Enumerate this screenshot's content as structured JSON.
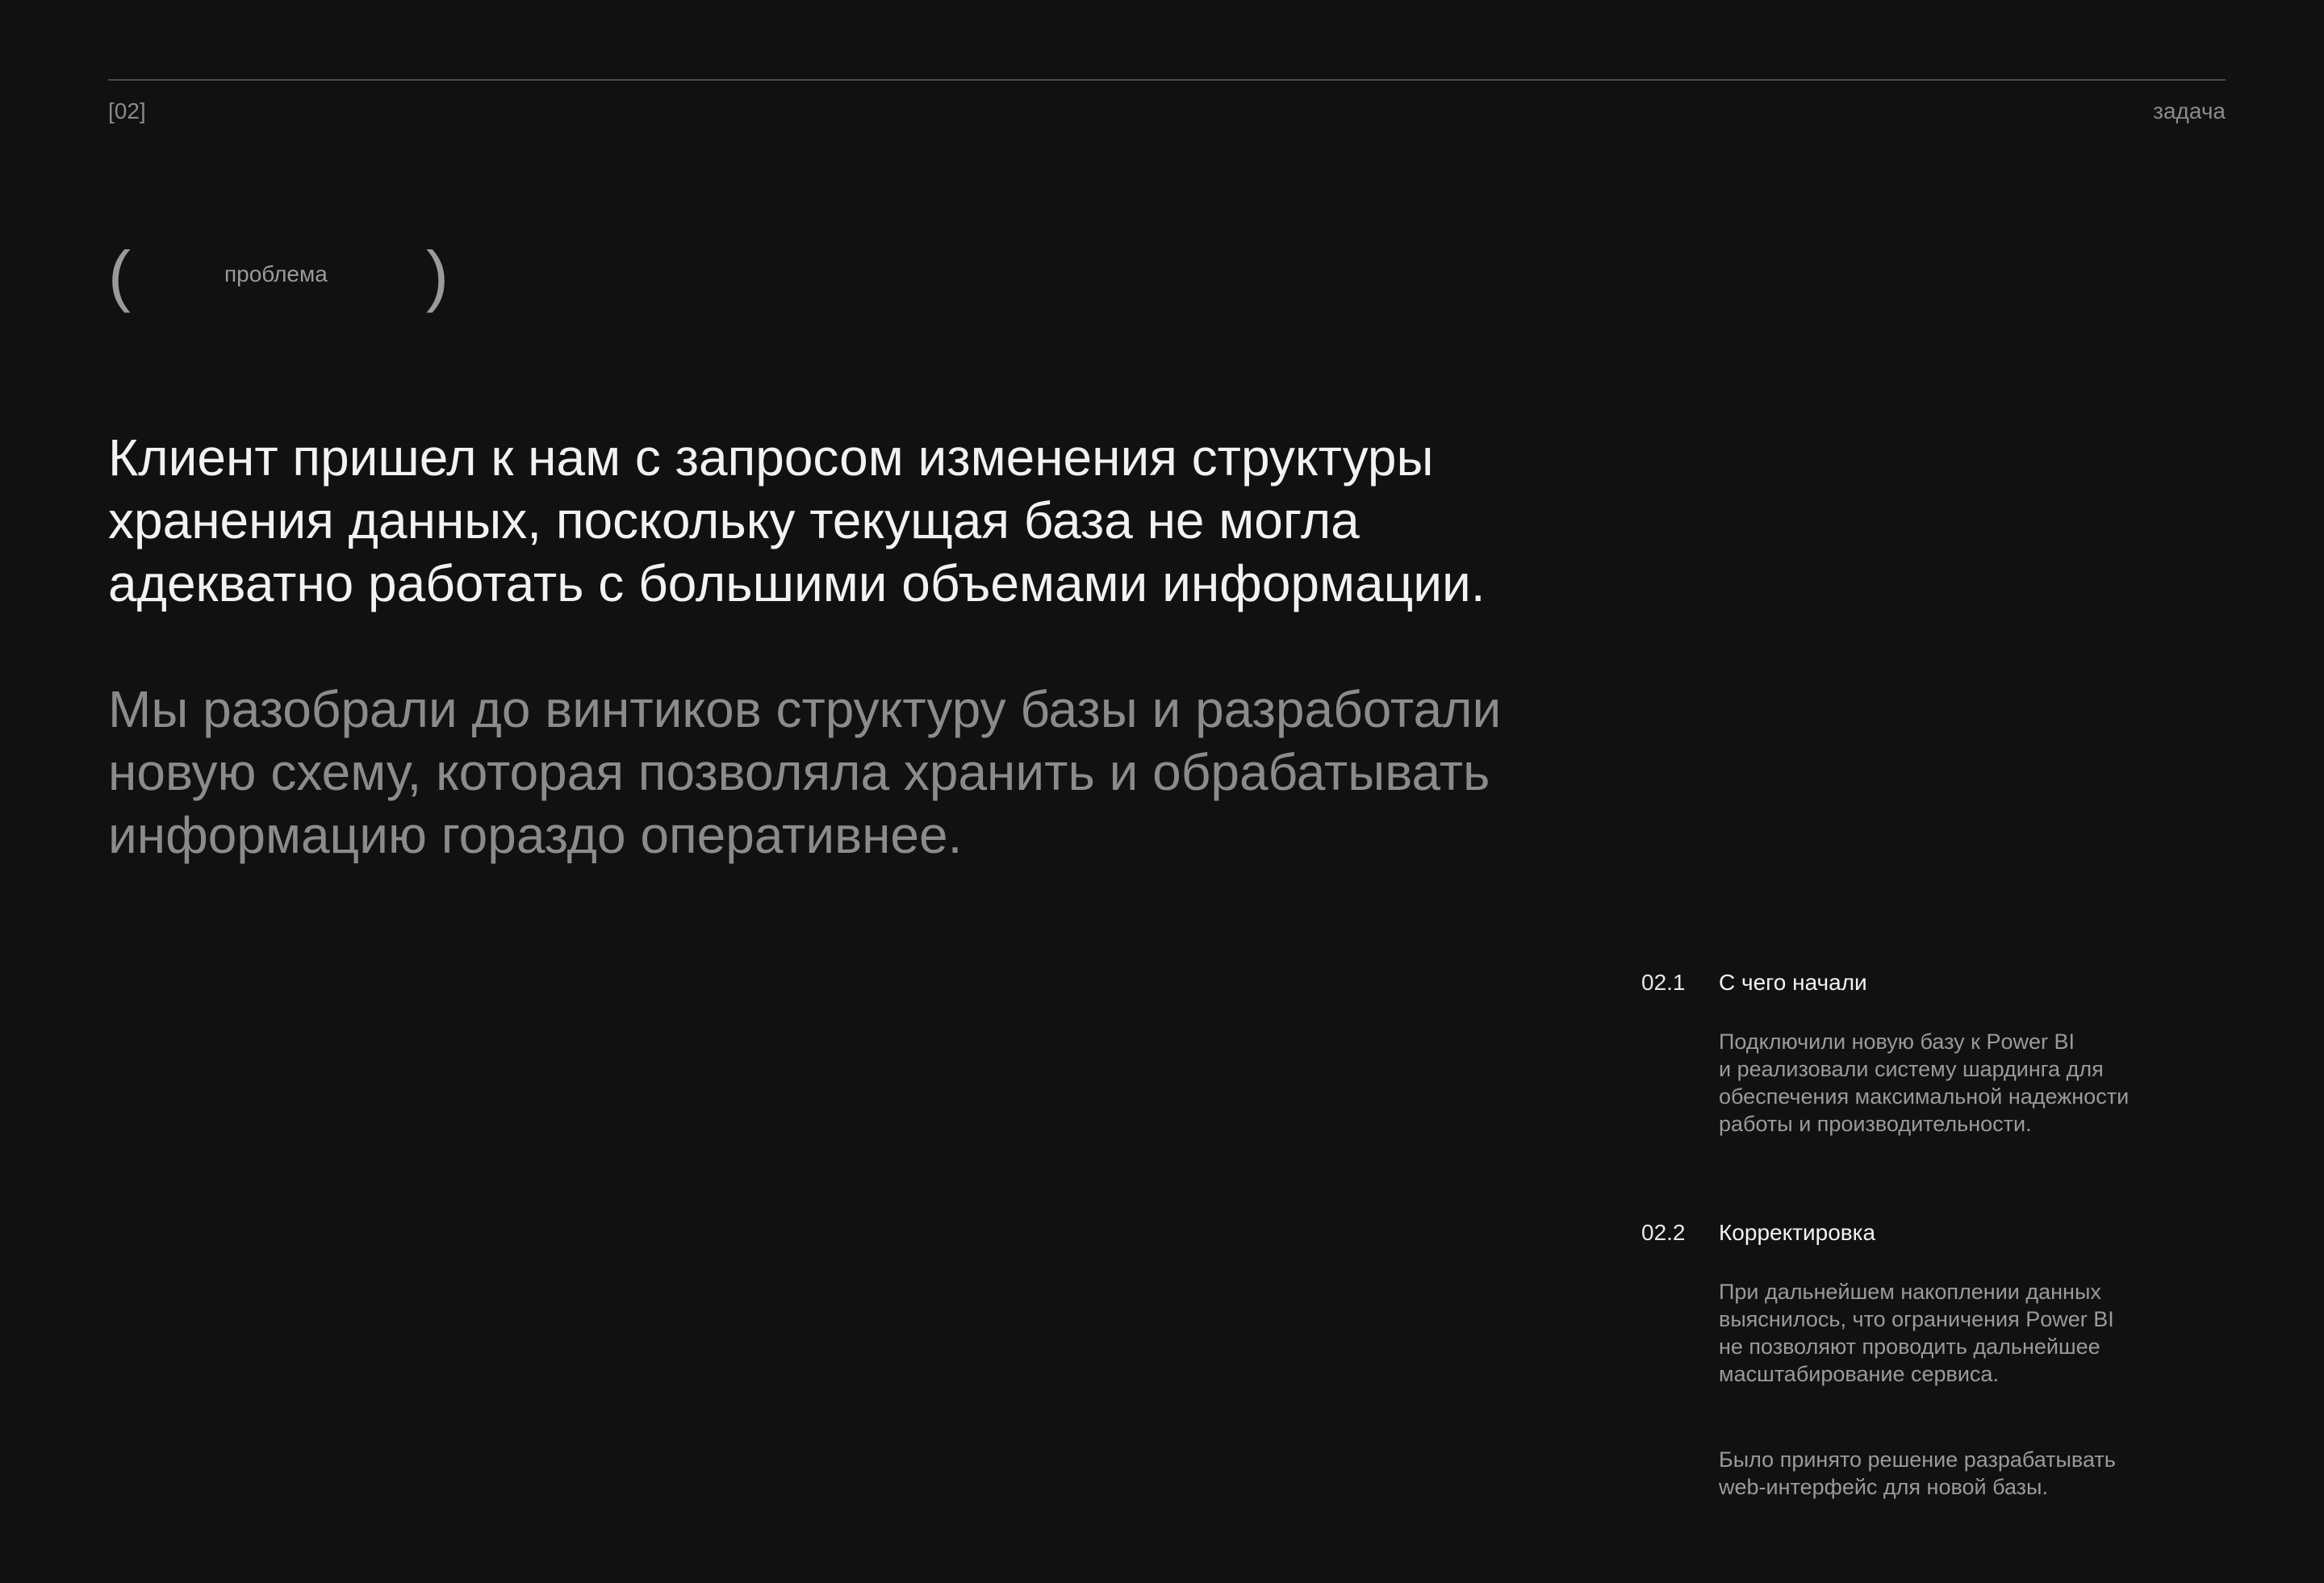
{
  "header": {
    "section_number": "[02]",
    "section_title": "задача"
  },
  "tag": {
    "open": "(",
    "label": "проблема",
    "close": ")"
  },
  "intro": {
    "lead": "Клиент пришел к нам с запросом изменения структуры\nхранения данных, поскольку текущая база не могла\nадекватно работать с большими объемами информации.",
    "secondary": "Мы разобрали до винтиков структуру базы и разработали\nновую схему, которая позволяла хранить и обрабатывать\nинформацию гораздо оперативнее."
  },
  "steps": [
    {
      "number": "02.1",
      "title": "С чего начали",
      "paragraphs": [
        "Подключили новую базу к Power BI\nи реализовали систему шардинга для\nобеспечения максимальной надежности\nработы и производительности."
      ]
    },
    {
      "number": "02.2",
      "title": "Корректировка",
      "paragraphs": [
        "При дальнейшем накоплении данных\nвыяснилось, что ограничения Power BI\nне позволяют проводить дальнейшее\nмасштабирование сервиса.",
        "Было принято решение разрабатывать\nweb-интерфейс для новой базы."
      ]
    }
  ],
  "colors": {
    "background": "#111111",
    "primary_text": "#f2f2f2",
    "secondary_text": "#8b8b8b",
    "rule": "#4a4a4a"
  }
}
